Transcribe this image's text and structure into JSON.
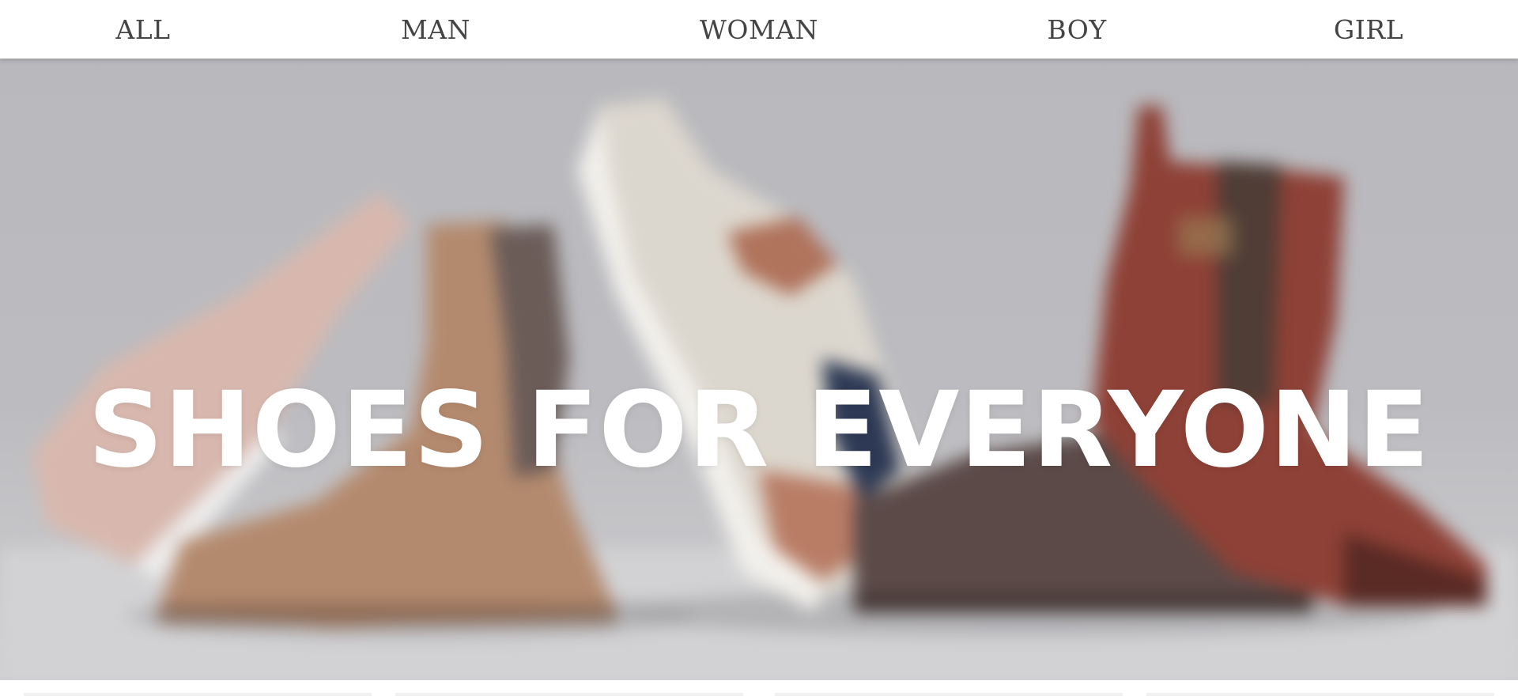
{
  "nav": {
    "items": [
      {
        "label": "ALL"
      },
      {
        "label": "MAN"
      },
      {
        "label": "WOMAN"
      },
      {
        "label": "BOY"
      },
      {
        "label": "GIRL"
      }
    ]
  },
  "hero": {
    "title": "SHOES FOR EVERYONE",
    "image_description_icon": "shoes-photo"
  },
  "colors": {
    "nav_text": "#444444",
    "nav_background": "#ffffff",
    "hero_title": "#ffffff",
    "hero_background": "#bcbcc0"
  }
}
